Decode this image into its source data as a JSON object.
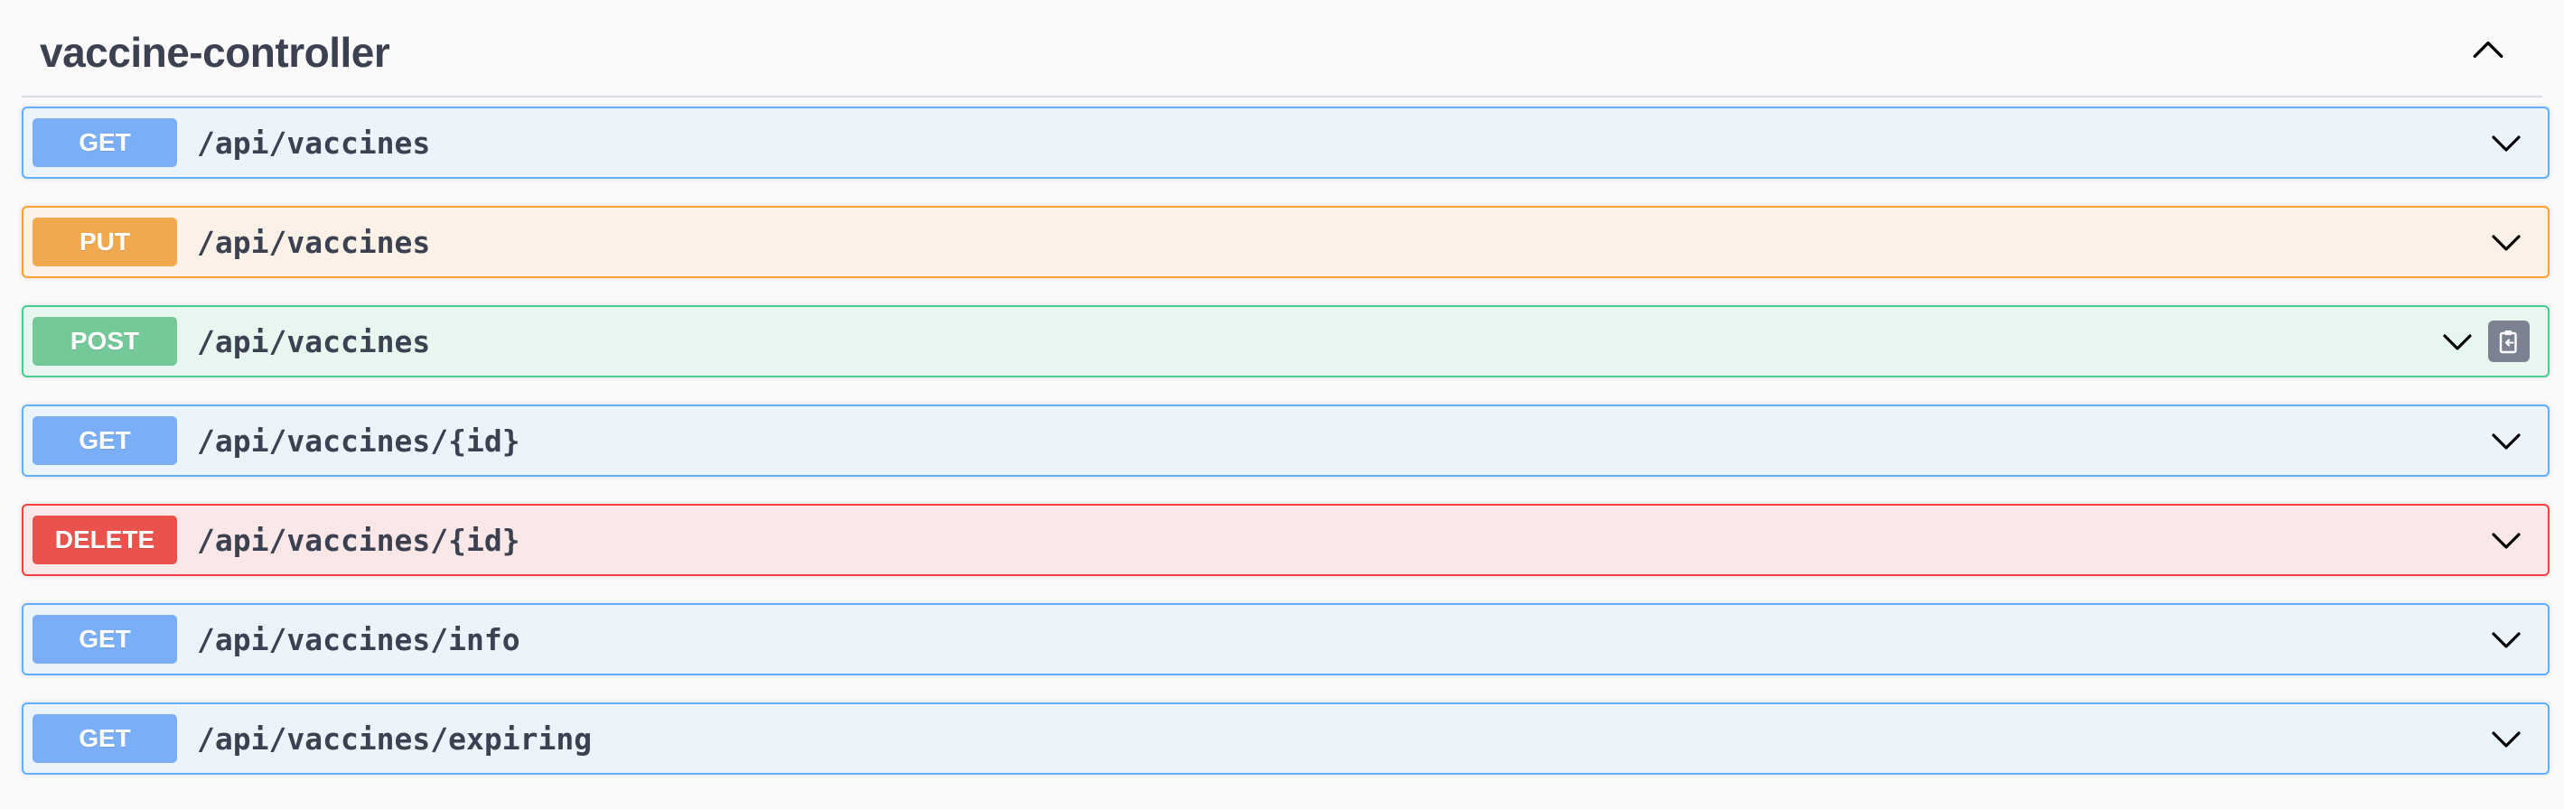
{
  "tag": {
    "title": "vaccine-controller"
  },
  "operations": [
    {
      "method": "GET",
      "path": "/api/vaccines"
    },
    {
      "method": "PUT",
      "path": "/api/vaccines"
    },
    {
      "method": "POST",
      "path": "/api/vaccines"
    },
    {
      "method": "GET",
      "path": "/api/vaccines/{id}"
    },
    {
      "method": "DELETE",
      "path": "/api/vaccines/{id}"
    },
    {
      "method": "GET",
      "path": "/api/vaccines/info"
    },
    {
      "method": "GET",
      "path": "/api/vaccines/expiring"
    }
  ],
  "icons": {
    "collapse": "chevron-up-icon",
    "expand": "chevron-down-icon",
    "copy": "clipboard-copy-icon"
  },
  "colors": {
    "get": "#61affe",
    "put": "#fca130",
    "post": "#49cc90",
    "delete": "#f93e3e"
  }
}
